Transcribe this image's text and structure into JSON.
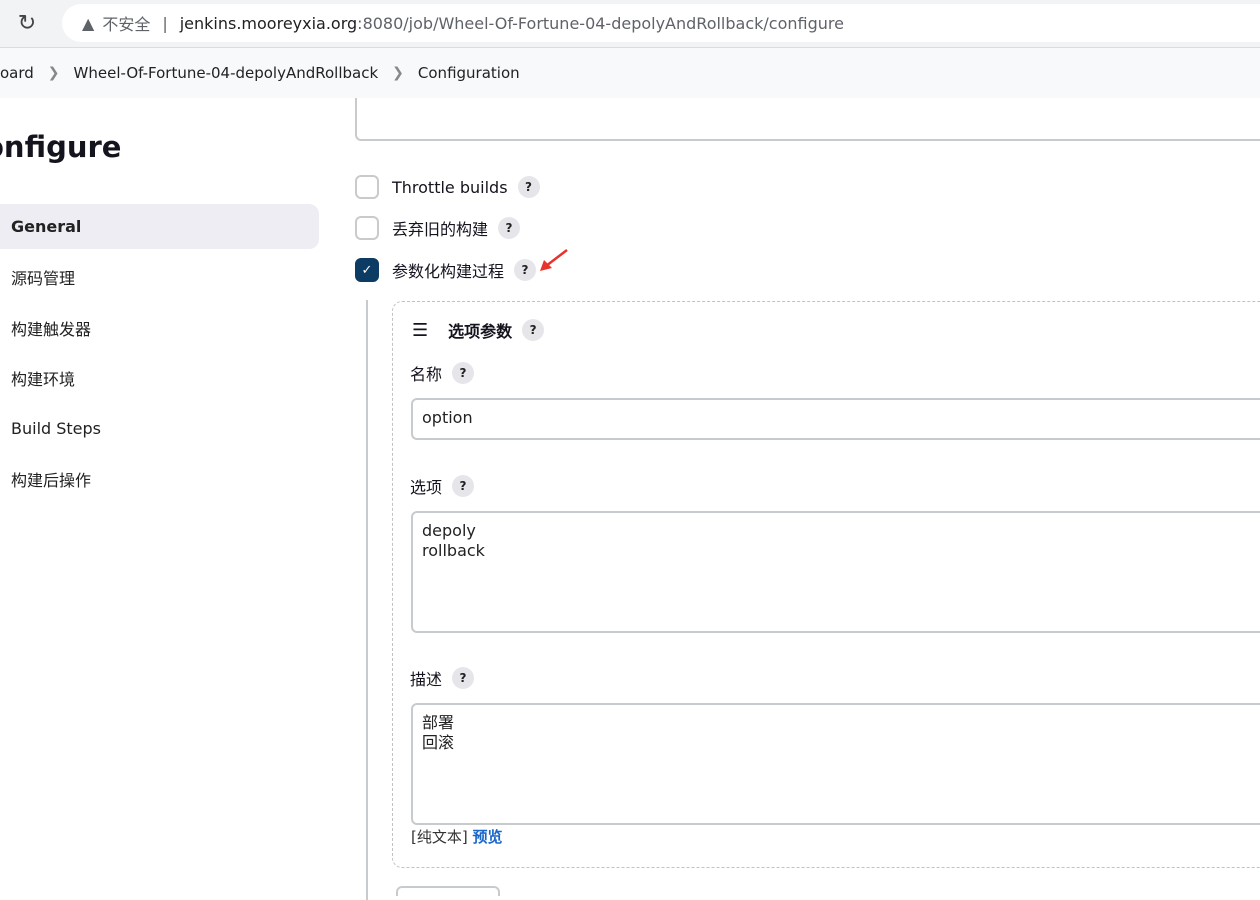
{
  "browser": {
    "security_label": "不安全",
    "url_host": "jenkins.mooreyxia.org",
    "url_path": ":8080/job/Wheel-Of-Fortune-04-depolyAndRollback/configure"
  },
  "breadcrumb": [
    "oard",
    "Wheel-Of-Fortune-04-depolyAndRollback",
    "Configuration"
  ],
  "page_title": "onfigure",
  "sidebar": {
    "items": [
      {
        "label": "General",
        "active": true
      },
      {
        "label": "源码管理"
      },
      {
        "label": "构建触发器"
      },
      {
        "label": "构建环境"
      },
      {
        "label": "Build Steps"
      },
      {
        "label": "构建后操作"
      }
    ]
  },
  "options": {
    "throttle": {
      "label": "Throttle builds",
      "checked": false
    },
    "discard": {
      "label": "丢弃旧的构建",
      "checked": false
    },
    "parameterized": {
      "label": "参数化构建过程",
      "checked": true
    }
  },
  "param": {
    "title": "选项参数",
    "name_label": "名称",
    "name_value": "option",
    "choices_label": "选项",
    "choices_value": "depoly\nrollback",
    "desc_label": "描述",
    "desc_value": "部署\n回滚",
    "plain_text": "[纯文本]",
    "preview": "预览"
  },
  "help_glyph": "?",
  "colors": {
    "accent": "#0c3b64",
    "link": "#1a66c9",
    "annotation_arrow": "#e8322b"
  }
}
